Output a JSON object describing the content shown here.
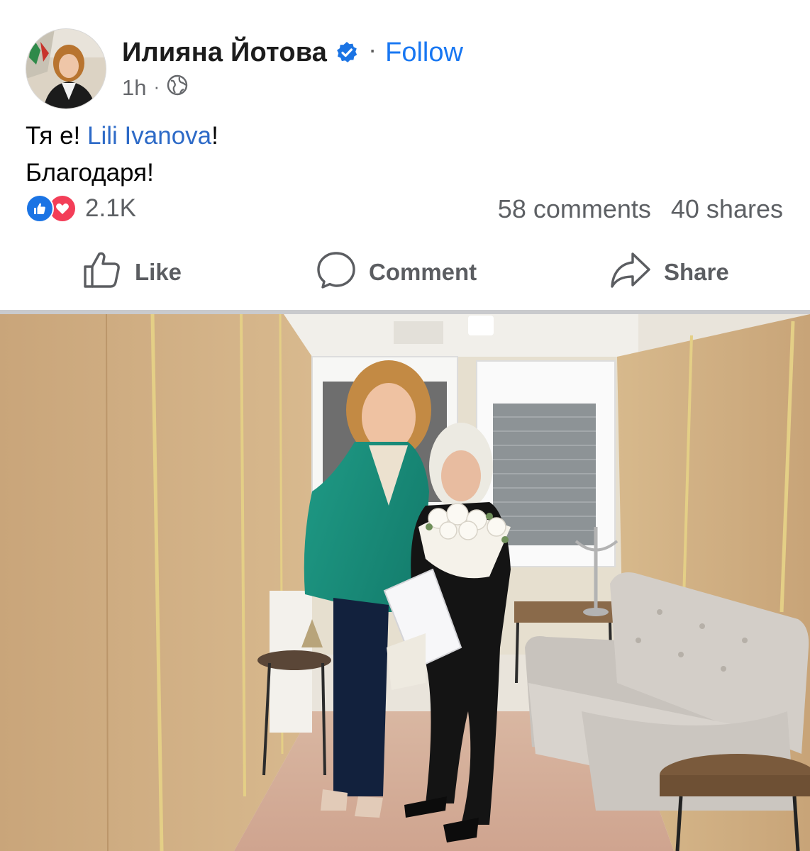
{
  "post": {
    "author": "Илияна Йотова",
    "follow_label": "Follow",
    "separator": "·",
    "timestamp": "1h",
    "meta_separator": "·",
    "text_line1_prefix": "Тя е! ",
    "mention": "Lili Ivanova",
    "text_line1_suffix": "!",
    "text_line2": "Благодаря!",
    "reaction_count": "2.1K",
    "comments": "58 comments",
    "shares": "40 shares"
  },
  "actions": {
    "like_label": "Like",
    "comment_label": "Comment",
    "share_label": "Share"
  },
  "icons": {
    "verified": "verified-badge-icon",
    "privacy": "globe-icon",
    "reactions": [
      "like-reaction-icon",
      "love-reaction-icon"
    ]
  },
  "colors": {
    "link": "#1877f2",
    "mention": "#2d6ac7",
    "like_reaction": "#1b74e4",
    "love_reaction": "#f33e58",
    "secondary_text": "#65676b"
  }
}
